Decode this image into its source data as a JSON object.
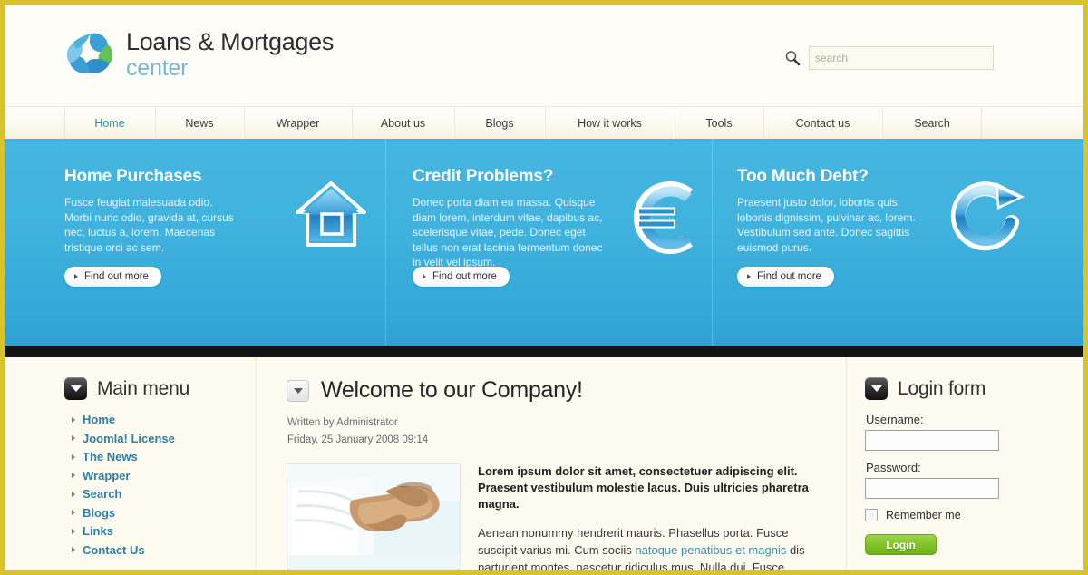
{
  "site": {
    "logo_line1": "Loans & Mortgages",
    "logo_line2": "center",
    "accent_blue": "#35a9d8",
    "accent_gold": "#d9c22a",
    "link_blue": "#2f7fa5",
    "login_green": "#82c52b"
  },
  "search": {
    "placeholder": "search",
    "value": "",
    "icon": "search-icon"
  },
  "nav": {
    "items": [
      {
        "label": "Home",
        "active": true
      },
      {
        "label": "News",
        "active": false
      },
      {
        "label": "Wrapper",
        "active": false
      },
      {
        "label": "About us",
        "active": false
      },
      {
        "label": "Blogs",
        "active": false
      },
      {
        "label": "How it works",
        "active": false
      },
      {
        "label": "Tools",
        "active": false
      },
      {
        "label": "Contact us",
        "active": false
      },
      {
        "label": "Search",
        "active": false
      }
    ]
  },
  "banner": {
    "columns": [
      {
        "title": "Home Purchases",
        "text": "Fusce feugiat malesuada odio. Morbi nunc odio, gravida at, cursus nec, luctus a, lorem. Maecenas tristique orci ac sem.",
        "button": "Find out more",
        "icon": "house-icon"
      },
      {
        "title": "Credit Problems?",
        "text": "Donec porta diam eu massa. Quisque diam lorem, interdum vitae, dapibus ac, scelerisque vitae, pede. Donec eget tellus non erat lacinia fermentum donec in velit vel ipsum.",
        "button": "Find out more",
        "icon": "euro-icon"
      },
      {
        "title": "Too Much Debt?",
        "text": "Praesent justo dolor, lobortis quis, lobortis dignissim, pulvinar ac, lorem. Vestibulum sed ante. Donec sagittis euismod purus.",
        "button": "Find out more",
        "icon": "refresh-arrow-icon"
      }
    ]
  },
  "sidebar_left": {
    "title": "Main menu",
    "items": [
      {
        "label": "Home"
      },
      {
        "label": "Joomla! License"
      },
      {
        "label": "The News"
      },
      {
        "label": "Wrapper"
      },
      {
        "label": "Search"
      },
      {
        "label": "Blogs"
      },
      {
        "label": "Links"
      },
      {
        "label": "Contact Us"
      }
    ]
  },
  "article": {
    "title": "Welcome to our Company!",
    "author_line": "Written by Administrator",
    "date_line": "Friday, 25 January 2008 09:14",
    "image_alt": "handshake-photo",
    "lead": "Lorem ipsum dolor sit amet, consectetuer adipiscing elit. Praesent vestibulum molestie lacus. Duis ultricies pharetra magna.",
    "body_before_link": "Aenean nonummy hendrerit mauris. Phasellus porta. Fusce suscipit varius mi. Cum sociis ",
    "body_link": "natoque penatibus et magnis",
    "body_after_link": " dis parturient montes, nascetur ridiculus mus. Nulla dui. Fusce"
  },
  "login": {
    "title": "Login form",
    "username_label": "Username:",
    "username_value": "",
    "password_label": "Password:",
    "password_value": "",
    "remember_label": "Remember me",
    "submit_label": "Login"
  }
}
